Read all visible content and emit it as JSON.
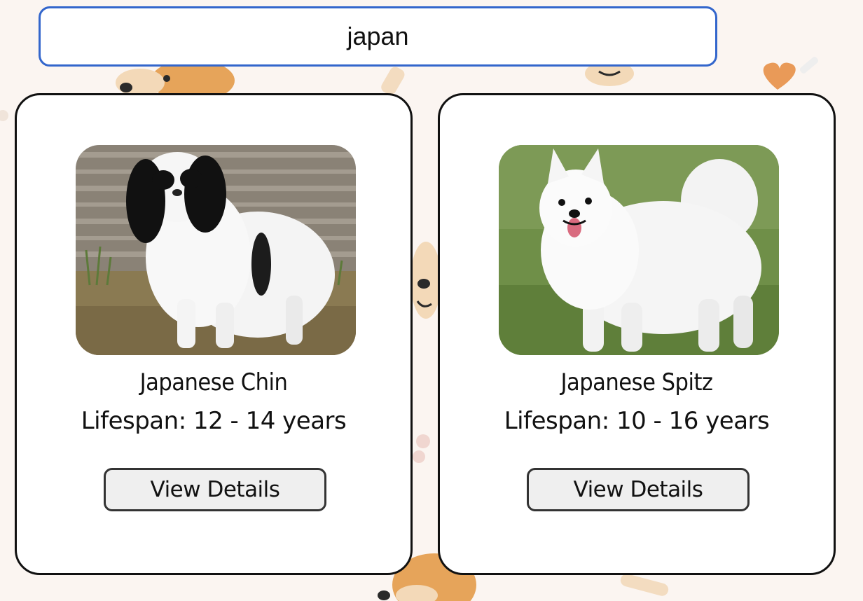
{
  "search": {
    "value": "japan",
    "placeholder": ""
  },
  "results": [
    {
      "name": "Japanese Chin",
      "lifespan": "Lifespan: 12 - 14 years",
      "button_label": "View Details",
      "photo": "japanese-chin-photo"
    },
    {
      "name": "Japanese Spitz",
      "lifespan": "Lifespan: 10 - 16 years",
      "button_label": "View Details",
      "photo": "japanese-spitz-photo"
    }
  ],
  "colors": {
    "background": "#fbf5f1",
    "search_border": "#3366cc",
    "card_border": "#111111",
    "button_bg": "#efefef"
  }
}
